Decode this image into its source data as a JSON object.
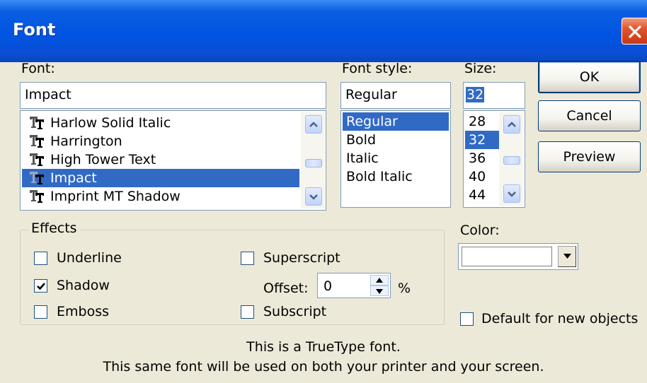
{
  "window": {
    "title": "Font"
  },
  "font": {
    "label": "Font:",
    "value": "Impact",
    "items": [
      "Harlow Solid Italic",
      "Harrington",
      "High Tower Text",
      "Impact",
      "Imprint MT Shadow"
    ],
    "selected": "Impact"
  },
  "style": {
    "label": "Font style:",
    "value": "Regular",
    "items": [
      "Regular",
      "Bold",
      "Italic",
      "Bold Italic"
    ],
    "selected": "Regular"
  },
  "size": {
    "label": "Size:",
    "value": "32",
    "items": [
      "28",
      "32",
      "36",
      "40",
      "44"
    ],
    "selected": "32"
  },
  "buttons": {
    "ok": "OK",
    "cancel": "Cancel",
    "preview": "Preview"
  },
  "effects": {
    "title": "Effects",
    "underline": {
      "label": "Underline",
      "checked": false
    },
    "shadow": {
      "label": "Shadow",
      "checked": true
    },
    "emboss": {
      "label": "Emboss",
      "checked": false
    },
    "superscript": {
      "label": "Superscript",
      "checked": false
    },
    "subscript": {
      "label": "Subscript",
      "checked": false
    },
    "offset": {
      "label": "Offset:",
      "value": "0",
      "unit": "%"
    }
  },
  "color": {
    "label": "Color:",
    "swatch": "#ffffff"
  },
  "default_for_new": {
    "label": "Default for new objects",
    "checked": false
  },
  "info": {
    "line1": "This is a TrueType font.",
    "line2": "This same font will be used on both your printer and your screen."
  },
  "colors": {
    "title_bar": "#0054e3",
    "selection": "#316ac5",
    "dialog_bg": "#ece9d8",
    "close_button": "#e2542c"
  }
}
